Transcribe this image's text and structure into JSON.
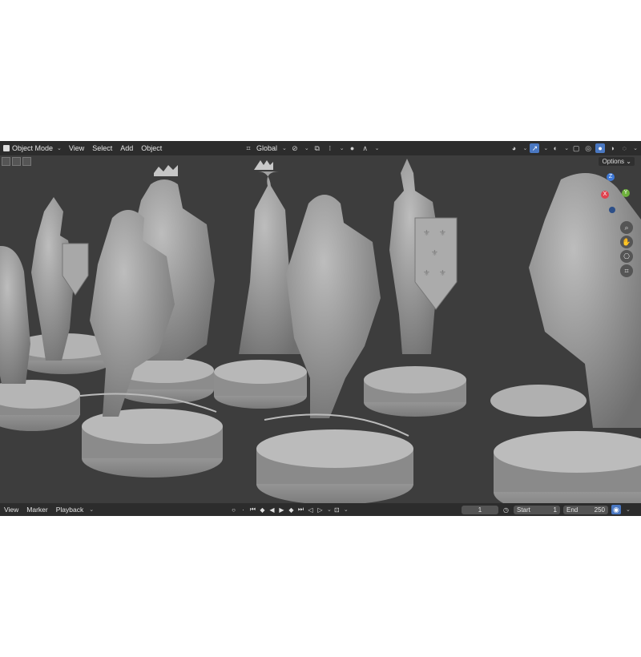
{
  "header": {
    "mode_label": "Object Mode",
    "menus": [
      "View",
      "Select",
      "Add",
      "Object"
    ],
    "transform_orientation": "Global",
    "viewport_options": "Options"
  },
  "timeline": {
    "menus": [
      "View",
      "Marker",
      "Playback"
    ],
    "current_frame": "1",
    "start_label": "Start",
    "start_value": "1",
    "end_label": "End",
    "end_value": "250"
  },
  "gizmo": {
    "x": "X",
    "y": "Y",
    "z": "Z"
  },
  "colors": {
    "accent": "#4a78c2",
    "header_bg": "#2c2c2c",
    "viewport_bg": "#3d3d3d",
    "model": "#9a9a9a"
  },
  "icons": [
    "move-icon",
    "link-icon",
    "snap-icon",
    "proportional-icon",
    "gizmo-icon",
    "overlay-icon",
    "xray-icon",
    "shading-icons",
    "zoom-icon",
    "hand-icon",
    "camera-icon",
    "grid-icon",
    "play-icon",
    "record-icon",
    "clock-icon"
  ]
}
